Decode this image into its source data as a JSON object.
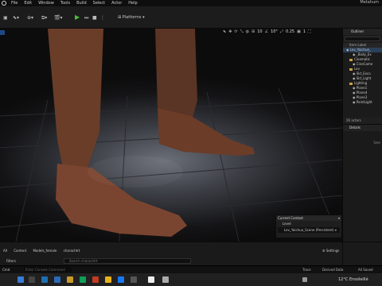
{
  "menu": {
    "items": [
      "File",
      "Edit",
      "Window",
      "Tools",
      "Build",
      "Select",
      "Actor",
      "Help"
    ],
    "title": "Metahum"
  },
  "toolbar": {
    "platforms_label": "Platforms"
  },
  "viewport_toolbar": {
    "grid_snap": "10",
    "rotation_snap": "10°",
    "scale_snap": "0.25",
    "camera_speed": "1"
  },
  "outliner": {
    "title": "Outliner",
    "header": "Item Label",
    "rows": [
      {
        "label": "Lev_Yaichuo_",
        "indent": 0,
        "folder": false,
        "sel": true
      },
      {
        "label": "_Body_Ex",
        "indent": 2,
        "folder": false,
        "sel": false
      },
      {
        "label": "Cinematic",
        "indent": 1,
        "folder": true,
        "sel": false
      },
      {
        "label": "CineCame",
        "indent": 2,
        "folder": false,
        "sel": false
      },
      {
        "label": "Lev",
        "indent": 1,
        "folder": true,
        "sel": false
      },
      {
        "label": "Skt_Exco",
        "indent": 2,
        "folder": false,
        "sel": false
      },
      {
        "label": "Skt_Light",
        "indent": 2,
        "folder": false,
        "sel": false
      },
      {
        "label": "Lighting",
        "indent": 1,
        "folder": true,
        "sel": false
      },
      {
        "label": "Plane1",
        "indent": 2,
        "folder": false,
        "sel": false
      },
      {
        "label": "Plane4",
        "indent": 2,
        "folder": false,
        "sel": false
      },
      {
        "label": "Plane3",
        "indent": 2,
        "folder": false,
        "sel": false
      },
      {
        "label": "PointLight",
        "indent": 2,
        "folder": false,
        "sel": false
      }
    ],
    "footer": "26 actors"
  },
  "details": {
    "title": "Details",
    "hint": "Sele"
  },
  "context": {
    "header": "Current Context",
    "level_label": "Level",
    "level_value": "Lev_Yaichuo_Scene (Persistent)"
  },
  "content_browser": {
    "path": [
      "All",
      "Content",
      "Models_female",
      "charachtrt"
    ],
    "settings_label": "Settings",
    "filters_label": "Filters",
    "search_placeholder": "Search charachtrt"
  },
  "status": {
    "cmd_label": "Cmd",
    "cmd_placeholder": "Enter Console Command",
    "trace_label": "Trace",
    "derived_data": "Derived Data",
    "revision_label": "All Saved"
  },
  "taskbar": {
    "weather": "12°C  Ensoleillé"
  }
}
